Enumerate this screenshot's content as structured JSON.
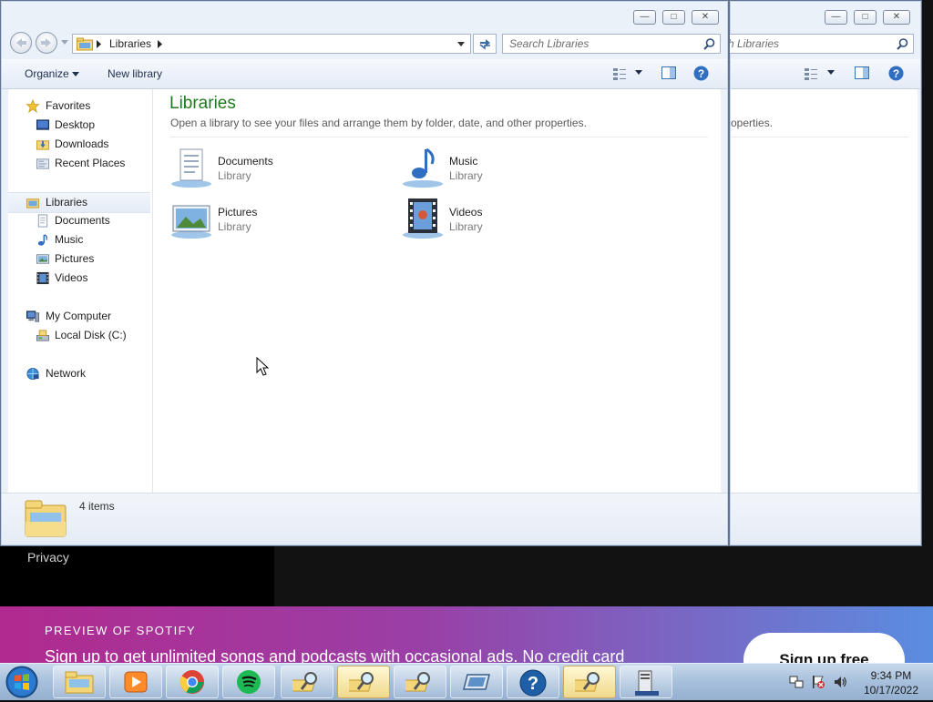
{
  "spotify": {
    "privacy_link": "Privacy",
    "preview_label": "PREVIEW OF SPOTIFY",
    "signup_text": "Sign up to get unlimited songs and podcasts with occasional ads. No credit card",
    "signup_button": "Sign up free"
  },
  "back_window": {
    "search_placeholder": "h Libraries",
    "desc_fragment": "operties."
  },
  "window": {
    "address": {
      "location": "Libraries"
    },
    "search_placeholder": "Search Libraries",
    "toolbar": {
      "organize": "Organize",
      "new_library": "New library"
    },
    "nav": {
      "favorites": "Favorites",
      "favorites_items": [
        "Desktop",
        "Downloads",
        "Recent Places"
      ],
      "libraries": "Libraries",
      "libraries_items": [
        "Documents",
        "Music",
        "Pictures",
        "Videos"
      ],
      "computer": "My Computer",
      "computer_items": [
        "Local Disk (C:)"
      ],
      "network": "Network"
    },
    "content": {
      "title": "Libraries",
      "description": "Open a library to see your files and arrange them by folder, date, and other properties.",
      "libraries": [
        {
          "name": "Documents",
          "kind": "Library"
        },
        {
          "name": "Music",
          "kind": "Library"
        },
        {
          "name": "Pictures",
          "kind": "Library"
        },
        {
          "name": "Videos",
          "kind": "Library"
        }
      ]
    },
    "status": {
      "item_count": "4 items"
    }
  },
  "taskbar": {
    "buttons": [
      "start-orb",
      "windows-explorer",
      "media-player",
      "chrome",
      "spotify",
      "search-folder",
      "search-folder",
      "search-folder",
      "removable-drive",
      "help-and-support",
      "search-folder",
      "task-manager"
    ],
    "clock": {
      "time": "9:34 PM",
      "date": "10/17/2022"
    }
  },
  "colors": {
    "library_title": "#1e7a1e",
    "spotify_gradient_start": "#b12a8f",
    "spotify_gradient_end": "#5a8de0"
  }
}
